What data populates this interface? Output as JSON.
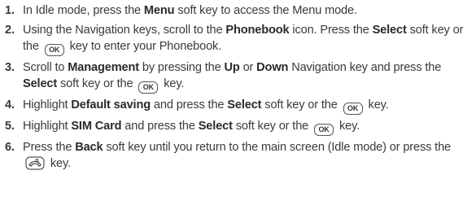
{
  "steps": [
    {
      "number": "1.",
      "segments": [
        {
          "type": "text",
          "value": "In Idle mode, press the "
        },
        {
          "type": "bold",
          "value": "Menu"
        },
        {
          "type": "text",
          "value": " soft key to access the Menu mode."
        }
      ]
    },
    {
      "number": "2.",
      "segments": [
        {
          "type": "text",
          "value": "Using the Navigation keys, scroll to the "
        },
        {
          "type": "bold",
          "value": "Phonebook"
        },
        {
          "type": "text",
          "value": " icon. Press the "
        },
        {
          "type": "bold",
          "value": "Select"
        },
        {
          "type": "text",
          "value": " soft key or the "
        },
        {
          "type": "key-ok",
          "value": "OK"
        },
        {
          "type": "text",
          "value": " key to enter your Phonebook."
        }
      ]
    },
    {
      "number": "3.",
      "segments": [
        {
          "type": "text",
          "value": "Scroll to "
        },
        {
          "type": "bold",
          "value": "Management"
        },
        {
          "type": "text",
          "value": " by pressing the "
        },
        {
          "type": "bold",
          "value": "Up"
        },
        {
          "type": "text",
          "value": " or "
        },
        {
          "type": "bold",
          "value": "Down"
        },
        {
          "type": "text",
          "value": " Navigation key and press the "
        },
        {
          "type": "bold",
          "value": "Select"
        },
        {
          "type": "text",
          "value": " soft key or the "
        },
        {
          "type": "key-ok",
          "value": "OK"
        },
        {
          "type": "text",
          "value": " key."
        }
      ]
    },
    {
      "number": "4.",
      "segments": [
        {
          "type": "text",
          "value": "Highlight "
        },
        {
          "type": "bold",
          "value": "Default saving"
        },
        {
          "type": "text",
          "value": " and press the "
        },
        {
          "type": "bold",
          "value": "Select"
        },
        {
          "type": "text",
          "value": " soft key or the "
        },
        {
          "type": "key-ok",
          "value": "OK"
        },
        {
          "type": "text",
          "value": " key."
        }
      ]
    },
    {
      "number": "5.",
      "segments": [
        {
          "type": "text",
          "value": "Highlight "
        },
        {
          "type": "bold",
          "value": "SIM Card"
        },
        {
          "type": "text",
          "value": " and press the "
        },
        {
          "type": "bold",
          "value": "Select"
        },
        {
          "type": "text",
          "value": " soft key or the "
        },
        {
          "type": "key-ok",
          "value": "OK"
        },
        {
          "type": "text",
          "value": " key."
        }
      ]
    },
    {
      "number": "6.",
      "segments": [
        {
          "type": "text",
          "value": "Press the "
        },
        {
          "type": "bold",
          "value": "Back"
        },
        {
          "type": "text",
          "value": " soft key until you return to the main screen (Idle mode) or press the "
        },
        {
          "type": "key-end",
          "value": "end-key-icon"
        },
        {
          "type": "text",
          "value": " key."
        }
      ]
    }
  ],
  "colors": {
    "text": "#3a3a3a",
    "bold": "#2a2a2a",
    "key_border": "#555555"
  }
}
